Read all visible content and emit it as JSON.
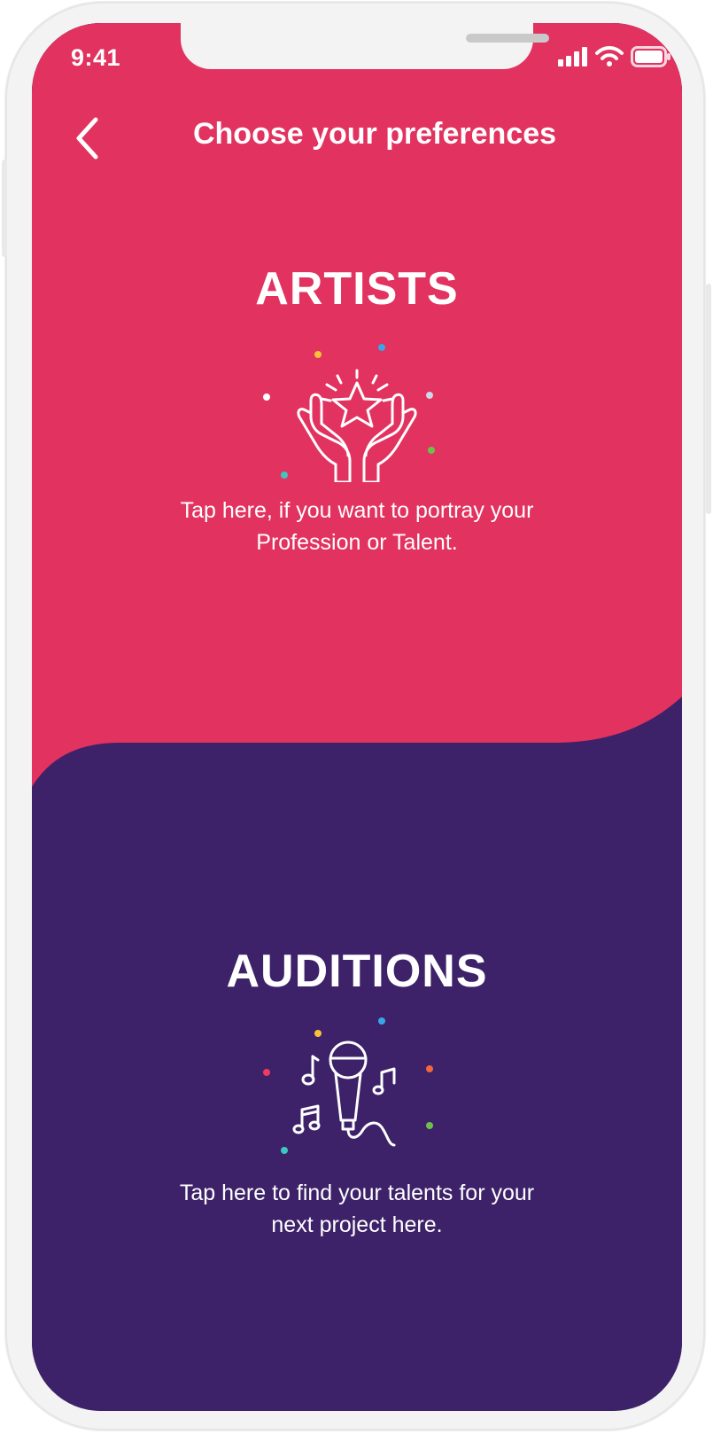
{
  "status_bar": {
    "time": "9:41",
    "icons": [
      "signal-icon",
      "wifi-icon",
      "battery-icon"
    ]
  },
  "header": {
    "title": "Choose your preferences",
    "back_icon": "chevron-left-icon"
  },
  "options": [
    {
      "title": "ARTISTS",
      "icon": "hands-star-icon",
      "description": "Tap here, if you want to portray your Profession or Talent.",
      "color": "#e2325f"
    },
    {
      "title": "AUDITIONS",
      "icon": "microphone-music-icon",
      "description": "Tap here to find your talents for your next project here.",
      "color": "#3d2269"
    }
  ],
  "colors": {
    "primary_pink": "#e2325f",
    "primary_purple": "#3d2269",
    "frame": "#f3f3f3"
  }
}
